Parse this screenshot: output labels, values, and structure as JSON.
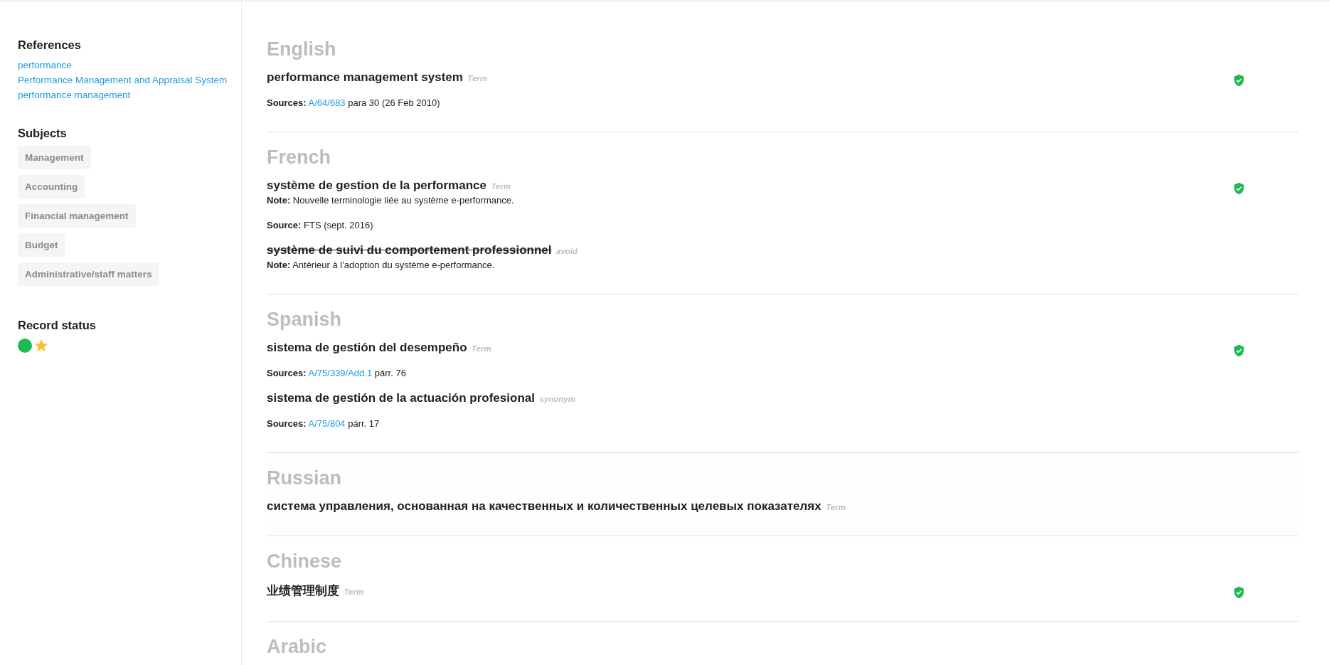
{
  "sidebar": {
    "references": {
      "title": "References",
      "links": [
        "performance",
        "Performance Management and Appraisal System",
        "performance management"
      ]
    },
    "subjects": {
      "title": "Subjects",
      "tags": [
        "Management",
        "Accounting",
        "Financial management",
        "Budget",
        "Administrative/staff matters"
      ]
    },
    "record_status": {
      "title": "Record status",
      "color": "#1db954",
      "starred": true
    }
  },
  "languages": [
    {
      "name": "English",
      "verified": true,
      "terms": [
        {
          "text": "performance management system",
          "type": "Term",
          "deprecated": false,
          "details": [
            {
              "kind": "source",
              "label": "Sources:",
              "link": "A/64/683",
              "text": "para 30 (26 Feb 2010)"
            }
          ]
        }
      ]
    },
    {
      "name": "French",
      "verified": true,
      "terms": [
        {
          "text": "système de gestion de la performance",
          "type": "Term",
          "deprecated": false,
          "details": [
            {
              "kind": "note",
              "label": "Note:",
              "text": "Nouvelle terminologie liée au système e-performance."
            },
            {
              "kind": "source",
              "label": "Source:",
              "text": "FTS (sept. 2016)"
            }
          ]
        },
        {
          "text": "système de suivi du comportement professionnel",
          "type": "avoid",
          "deprecated": true,
          "details": [
            {
              "kind": "note",
              "label": "Note:",
              "text": "Antérieur à l'adoption du système e-performance."
            }
          ]
        }
      ]
    },
    {
      "name": "Spanish",
      "verified": true,
      "terms": [
        {
          "text": "sistema de gestión del desempeño",
          "type": "Term",
          "deprecated": false,
          "details": [
            {
              "kind": "source",
              "label": "Sources:",
              "link": "A/75/339/Add.1",
              "text": "párr. 76"
            }
          ]
        },
        {
          "text": "sistema de gestión de la actuación profesional",
          "type": "synonym",
          "deprecated": false,
          "details": [
            {
              "kind": "source",
              "label": "Sources:",
              "link": "A/75/804",
              "text": "párr. 17"
            }
          ]
        }
      ]
    },
    {
      "name": "Russian",
      "verified": false,
      "terms": [
        {
          "text": "система управления, основанная на качественных и количественных целевых показателях",
          "type": "Term",
          "deprecated": false
        }
      ]
    },
    {
      "name": "Chinese",
      "verified": true,
      "terms": [
        {
          "text": "业绩管理制度",
          "type": "Term",
          "deprecated": false
        }
      ]
    },
    {
      "name": "Arabic"
    }
  ]
}
